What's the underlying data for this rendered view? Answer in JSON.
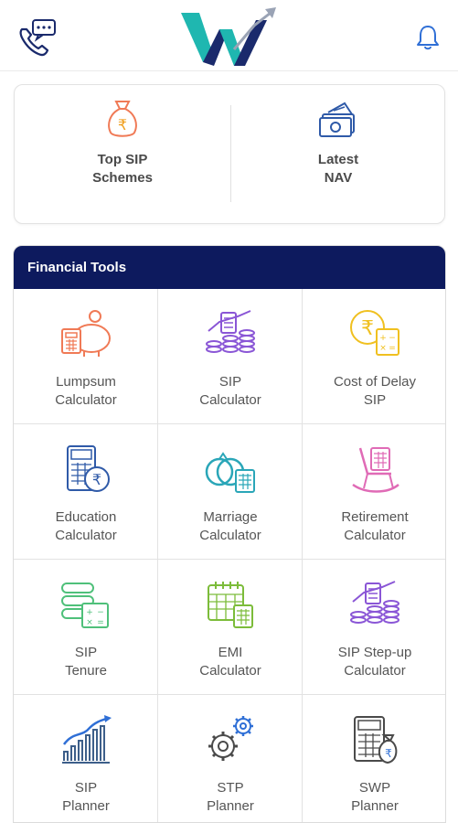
{
  "header": {
    "contact_icon": "phone-chat-icon",
    "logo_icon": "brand-w-logo",
    "notification_icon": "bell-icon"
  },
  "quick_links": [
    {
      "line1": "Top SIP",
      "line2": "Schemes",
      "icon": "money-bag-rupee-icon"
    },
    {
      "line1": "Latest",
      "line2": "NAV",
      "icon": "cash-stack-icon"
    }
  ],
  "tools": {
    "title": "Financial Tools",
    "items": [
      {
        "line1": "Lumpsum",
        "line2": "Calculator",
        "icon": "piggy-bank-icon"
      },
      {
        "line1": "SIP",
        "line2": "Calculator",
        "icon": "calculator-coins-icon"
      },
      {
        "line1": "Cost of Delay",
        "line2": "SIP",
        "icon": "rupee-calculator-icon"
      },
      {
        "line1": "Education",
        "line2": "Calculator",
        "icon": "education-calculator-icon"
      },
      {
        "line1": "Marriage",
        "line2": "Calculator",
        "icon": "rings-calculator-icon"
      },
      {
        "line1": "Retirement",
        "line2": "Calculator",
        "icon": "rocking-chair-icon"
      },
      {
        "line1": "SIP",
        "line2": "Tenure",
        "icon": "tenure-calculator-icon"
      },
      {
        "line1": "EMI",
        "line2": "Calculator",
        "icon": "calendar-calculator-icon"
      },
      {
        "line1": "SIP Step-up",
        "line2": "Calculator",
        "icon": "step-up-coins-icon"
      },
      {
        "line1": "SIP",
        "line2": "Planner",
        "icon": "growth-bars-icon"
      },
      {
        "line1": "STP",
        "line2": "Planner",
        "icon": "gears-icon"
      },
      {
        "line1": "SWP",
        "line2": "Planner",
        "icon": "calculator-money-bag-icon"
      }
    ]
  },
  "colors": {
    "tools_header_bg": "#0d1a5e",
    "brand_teal": "#1fb7b0",
    "brand_navy": "#1a2a6c",
    "icon_orange": "#f07a56",
    "icon_purple": "#8a56d6",
    "icon_yellow": "#f0c020",
    "icon_blue": "#2f5aa8",
    "icon_teal": "#2aa6b8",
    "icon_pink": "#e06bb6",
    "icon_green": "#4fc07a",
    "icon_lime": "#7cbc3a",
    "icon_steel": "#3d5f8a"
  }
}
